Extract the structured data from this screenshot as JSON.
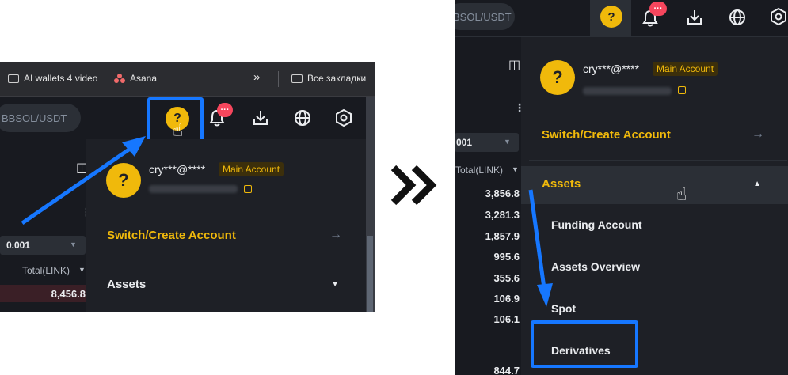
{
  "left": {
    "bookmarks": [
      {
        "label": "AI wallets 4 video",
        "icon": "folder-icon"
      },
      {
        "label": "Asana",
        "icon": "asana-icon"
      },
      {
        "label": "»",
        "icon": "more-bookmarks-icon"
      },
      {
        "label": "Все закладки",
        "icon": "folder-icon"
      }
    ],
    "pair": "BBSOL/USDT",
    "notif_badge": "···",
    "account": {
      "email": "cry***@****",
      "badge": "Main Account"
    },
    "menu": {
      "switch": "Switch/Create Account",
      "assets": "Assets"
    },
    "orderbook": {
      "step": "0.001",
      "total_label": "Total(LINK)",
      "values": [
        "8,456.8"
      ]
    }
  },
  "right": {
    "pair": "BSOL/USDT",
    "notif_badge": "···",
    "account": {
      "email": "cry***@****",
      "badge": "Main Account"
    },
    "menu": {
      "switch": "Switch/Create Account",
      "assets": "Assets",
      "funding": "Funding Account",
      "overview": "Assets Overview",
      "spot": "Spot",
      "derivatives": "Derivatives"
    },
    "orderbook": {
      "step": "001",
      "total_label": "Total(LINK)",
      "values": [
        "3,856.8",
        "3,281.3",
        "1,857.9",
        "995.6",
        "355.6",
        "106.9",
        "106.1",
        "844.7"
      ]
    }
  },
  "colors": {
    "accent": "#f0b90b",
    "highlight": "#1677ff",
    "bg": "#181a20",
    "panel": "#1e2026"
  }
}
